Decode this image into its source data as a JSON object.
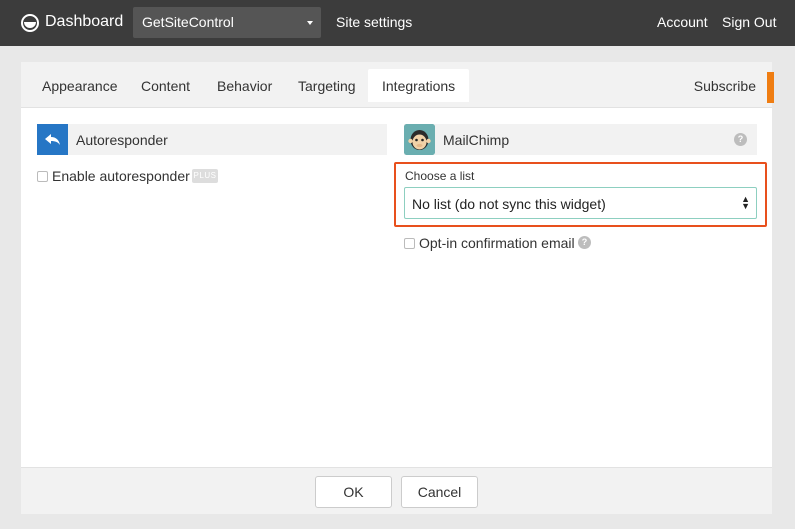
{
  "topbar": {
    "brand": "Dashboard",
    "site_select": "GetSiteControl",
    "site_settings": "Site settings",
    "account": "Account",
    "sign_out": "Sign Out"
  },
  "tabs": [
    {
      "label": "Appearance"
    },
    {
      "label": "Content"
    },
    {
      "label": "Behavior"
    },
    {
      "label": "Targeting"
    },
    {
      "label": "Integrations",
      "active": true
    }
  ],
  "widget_type": "Subscribe",
  "autoresponder": {
    "title": "Autoresponder",
    "enable_label": "Enable autoresponder",
    "badge": "PLUS",
    "enabled": false
  },
  "mailchimp": {
    "title": "MailChimp",
    "help": "?",
    "choose_label": "Choose a list",
    "selected_list": "No list (do not sync this widget)",
    "optin_label": "Opt-in confirmation email",
    "optin_checked": false
  },
  "footer": {
    "ok": "OK",
    "cancel": "Cancel"
  },
  "colors": {
    "topbar": "#3c3c3c",
    "accent_blue": "#2676c5",
    "highlight": "#e8501d",
    "flag": "#ef7d12"
  }
}
